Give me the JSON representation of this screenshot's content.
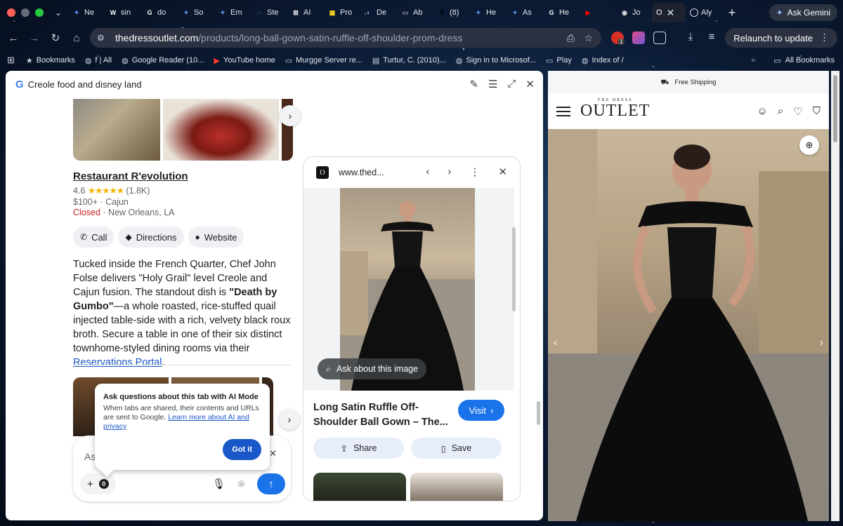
{
  "browser": {
    "tabs": [
      {
        "label": "Ne",
        "icon": "gemini-icon",
        "color": "#5b8def"
      },
      {
        "label": "sin",
        "icon": "wikipedia-icon",
        "color": "#ffffff"
      },
      {
        "label": "do",
        "icon": "google-icon",
        "color": "#ffffff"
      },
      {
        "label": "So",
        "icon": "gemini-icon",
        "color": "#5b8def"
      },
      {
        "label": "Em",
        "icon": "gemini-icon",
        "color": "#5b8def"
      },
      {
        "label": "Ste",
        "icon": "spinner-icon",
        "color": "#8ab4f8"
      },
      {
        "label": "AI",
        "icon": "grid-icon",
        "color": "#ffffff"
      },
      {
        "label": "Pro",
        "icon": "yellow-app-icon",
        "color": "#f9d923"
      },
      {
        "label": "De",
        "icon": "loading-icon",
        "color": "#8ab4f8"
      },
      {
        "label": "Ab",
        "icon": "page-icon",
        "color": "#999999"
      },
      {
        "label": "(8)",
        "icon": "x-icon",
        "color": "#000000"
      },
      {
        "label": "He",
        "icon": "gemini-icon",
        "color": "#5b8def"
      },
      {
        "label": "As",
        "icon": "gemini-icon",
        "color": "#5b8def"
      },
      {
        "label": "He",
        "icon": "google-icon",
        "color": "#ffffff"
      },
      {
        "label": "",
        "icon": "youtube-icon",
        "color": "#ff0000"
      },
      {
        "label": "Jo",
        "icon": "profile-icon",
        "color": "#dddddd"
      }
    ],
    "active_tab": {
      "label": "O",
      "icon": "outlet-icon"
    },
    "after_tab": {
      "label": "Aly",
      "icon": "globe-icon"
    },
    "ask_gemini": "Ask Gemini",
    "url_host": "thedressoutlet.com",
    "url_path": "/products/long-ball-gown-satin-ruffle-off-shoulder-prom-dress",
    "relaunch": "Relaunch to update",
    "extension_badge": "1",
    "bookmarks": [
      {
        "label": "Bookmarks",
        "icon": "star-icon"
      },
      {
        "label": "f | All",
        "icon": "globe-icon"
      },
      {
        "label": "Google Reader (10...",
        "icon": "globe-icon"
      },
      {
        "label": "YouTube home",
        "icon": "youtube-icon"
      },
      {
        "label": "Murgge Server re...",
        "icon": "folder-icon"
      },
      {
        "label": "Turtur, C. (2010)...",
        "icon": "page-icon"
      },
      {
        "label": "Sign in to Microsof...",
        "icon": "globe-icon"
      },
      {
        "label": "Play",
        "icon": "folder-icon"
      },
      {
        "label": "Index of /",
        "icon": "globe-icon"
      }
    ],
    "all_bookmarks": "All Bookmarks"
  },
  "ai_panel": {
    "title": "Creole food and disney land",
    "restaurant": {
      "name": "Restaurant R'evolution",
      "rating": "4.6",
      "stars": "★★★★★",
      "reviews": "(1.8K)",
      "price_cuisine": "$100+ · Cajun",
      "status": "Closed",
      "location": "· New Orleans, LA"
    },
    "chips": {
      "call": "Call",
      "directions": "Directions",
      "website": "Website"
    },
    "description": {
      "part1": "Tucked inside the French Quarter, Chef John Folse delivers \"Holy Grail\" level Creole and Cajun fusion. The standout dish is ",
      "bold": "\"Death by Gumbo\"",
      "part2": "—a whole roasted, rice-stuffed quail injected table-side with a rich, velvety black roux broth. Secure a table in one of their six distinct townhome-styled dining rooms via their ",
      "link": "Reservations Portal",
      "part3": "."
    },
    "ask_placeholder": "As",
    "tab_count": "0",
    "tooltip": {
      "title": "Ask questions about this tab with AI Mode",
      "body": "When tabs are shared, their contents and URLs are sent to Google. ",
      "link": "Learn more about AI and privacy",
      "button": "Got it"
    },
    "side_card": {
      "favicon": "O",
      "url": "www.thed...",
      "ask_image": "Ask about this image",
      "product_title": "Long Satin Ruffle Off-Shoulder Ball Gown – The...",
      "visit": "Visit",
      "share": "Share",
      "save": "Save"
    }
  },
  "site": {
    "shipping": "Free Shipping",
    "logo_small": "THE DRESS",
    "logo_big": "OUTLET"
  }
}
